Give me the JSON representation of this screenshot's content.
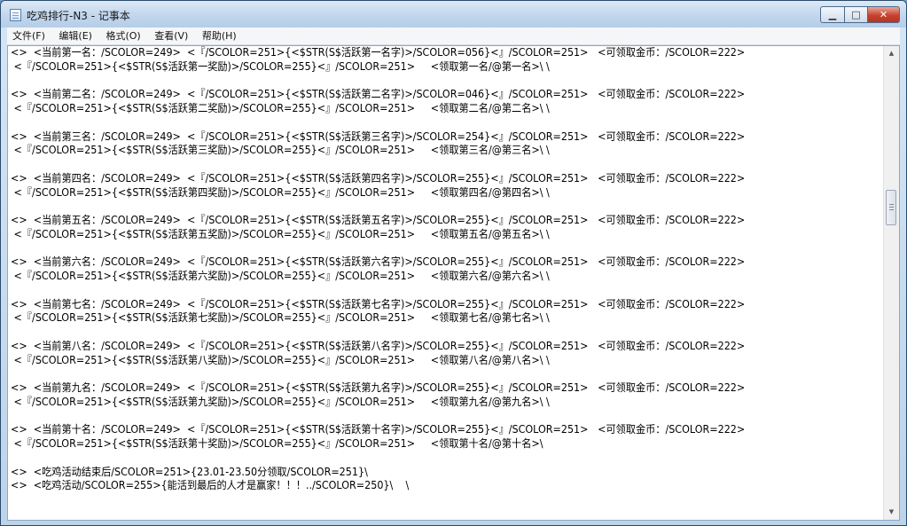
{
  "window": {
    "title": "吃鸡排行-N3 - 记事本"
  },
  "controls": {
    "minimize": "▁",
    "maximize": "□",
    "close": "✕"
  },
  "menu": [
    "文件(F)",
    "编辑(E)",
    "格式(O)",
    "查看(V)",
    "帮助(H)"
  ],
  "scrollbar": {
    "up": "▲",
    "down": "▼"
  },
  "lines": [
    "<>  <当前第一名：/SCOLOR=249>  <『/SCOLOR=251>{<$STR(S$活跃第一名字)>/SCOLOR=056}<』/SCOLOR=251>   <可领取金币：/SCOLOR=222>",
    " <『/SCOLOR=251>{<$STR(S$活跃第一奖励)>/SCOLOR=255}<』/SCOLOR=251>     <领取第一名/@第一名>\\ \\",
    "",
    "<>  <当前第二名：/SCOLOR=249>  <『/SCOLOR=251>{<$STR(S$活跃第二名字)>/SCOLOR=046}<』/SCOLOR=251>   <可领取金币：/SCOLOR=222>",
    " <『/SCOLOR=251>{<$STR(S$活跃第二奖励)>/SCOLOR=255}<』/SCOLOR=251>     <领取第二名/@第二名>\\ \\",
    "",
    "<>  <当前第三名：/SCOLOR=249>  <『/SCOLOR=251>{<$STR(S$活跃第三名字)>/SCOLOR=254}<』/SCOLOR=251>   <可领取金币：/SCOLOR=222>",
    " <『/SCOLOR=251>{<$STR(S$活跃第三奖励)>/SCOLOR=255}<』/SCOLOR=251>     <领取第三名/@第三名>\\ \\",
    "",
    "<>  <当前第四名：/SCOLOR=249>  <『/SCOLOR=251>{<$STR(S$活跃第四名字)>/SCOLOR=255}<』/SCOLOR=251>   <可领取金币：/SCOLOR=222>",
    " <『/SCOLOR=251>{<$STR(S$活跃第四奖励)>/SCOLOR=255}<』/SCOLOR=251>     <领取第四名/@第四名>\\ \\",
    "",
    "<>  <当前第五名：/SCOLOR=249>  <『/SCOLOR=251>{<$STR(S$活跃第五名字)>/SCOLOR=255}<』/SCOLOR=251>   <可领取金币：/SCOLOR=222>",
    " <『/SCOLOR=251>{<$STR(S$活跃第五奖励)>/SCOLOR=255}<』/SCOLOR=251>     <领取第五名/@第五名>\\ \\",
    "",
    "<>  <当前第六名：/SCOLOR=249>  <『/SCOLOR=251>{<$STR(S$活跃第六名字)>/SCOLOR=255}<』/SCOLOR=251>   <可领取金币：/SCOLOR=222>",
    " <『/SCOLOR=251>{<$STR(S$活跃第六奖励)>/SCOLOR=255}<』/SCOLOR=251>     <领取第六名/@第六名>\\ \\",
    "",
    "<>  <当前第七名：/SCOLOR=249>  <『/SCOLOR=251>{<$STR(S$活跃第七名字)>/SCOLOR=255}<』/SCOLOR=251>   <可领取金币：/SCOLOR=222>",
    " <『/SCOLOR=251>{<$STR(S$活跃第七奖励)>/SCOLOR=255}<』/SCOLOR=251>     <领取第七名/@第七名>\\ \\",
    "",
    "<>  <当前第八名：/SCOLOR=249>  <『/SCOLOR=251>{<$STR(S$活跃第八名字)>/SCOLOR=255}<』/SCOLOR=251>   <可领取金币：/SCOLOR=222>",
    " <『/SCOLOR=251>{<$STR(S$活跃第八奖励)>/SCOLOR=255}<』/SCOLOR=251>     <领取第八名/@第八名>\\ \\",
    "",
    "<>  <当前第九名：/SCOLOR=249>  <『/SCOLOR=251>{<$STR(S$活跃第九名字)>/SCOLOR=255}<』/SCOLOR=251>   <可领取金币：/SCOLOR=222>",
    " <『/SCOLOR=251>{<$STR(S$活跃第九奖励)>/SCOLOR=255}<』/SCOLOR=251>     <领取第九名/@第九名>\\ \\",
    "",
    "<>  <当前第十名：/SCOLOR=249>  <『/SCOLOR=251>{<$STR(S$活跃第十名字)>/SCOLOR=255}<』/SCOLOR=251>   <可领取金币：/SCOLOR=222>",
    " <『/SCOLOR=251>{<$STR(S$活跃第十奖励)>/SCOLOR=255}<』/SCOLOR=251>     <领取第十名/@第十名>\\",
    "",
    "<>  <吃鸡活动结束后/SCOLOR=251>{23.01-23.50分领取/SCOLOR=251}\\",
    "<>  <吃鸡活动/SCOLOR=255>{能活到最后的人才是赢家！！！../SCOLOR=250}\\    \\"
  ]
}
